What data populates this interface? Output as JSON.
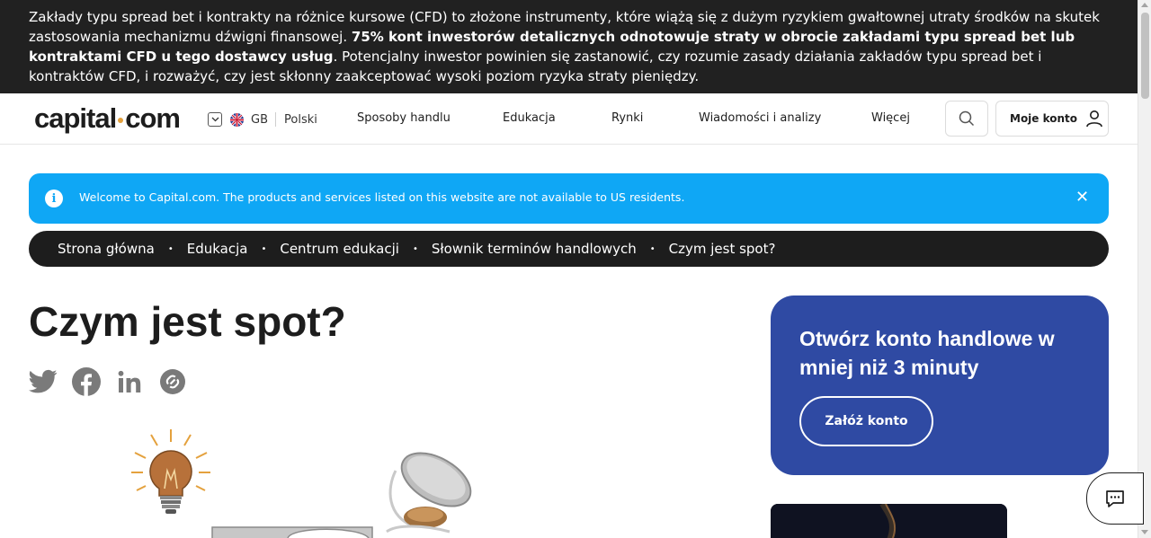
{
  "risk": {
    "part1": "Zakłady typu spread bet i kontrakty na różnice kursowe (CFD) to złożone instrumenty, które wiążą się z dużym ryzykiem gwałtownej utraty środków na skutek zastosowania mechanizmu dźwigni finansowej. ",
    "bold": "75% kont inwestorów detalicznych odnotowuje straty w obrocie zakładami typu spread bet lub kontraktami CFD u tego dostawcy usług",
    "part2": ". Potencjalny inwestor powinien się zastanowić, czy rozumie zasady działania zakładów typu spread bet i kontraktów CFD, i rozważyć, czy jest skłonny zaakceptować wysoki poziom ryzyka straty pieniędzy."
  },
  "header": {
    "logo_left": "capital",
    "logo_right": "com",
    "region_code": "GB",
    "language": "Polski",
    "nav": [
      "Sposoby handlu",
      "Edukacja",
      "Rynki",
      "Wiadomości i analizy",
      "Więcej"
    ],
    "account_label": "Moje konto"
  },
  "info": {
    "icon": "i",
    "text": "Welcome to Capital.com. The products and services listed on this website are not available to US residents.",
    "close": "✕"
  },
  "breadcrumb": [
    "Strona główna",
    "Edukacja",
    "Centrum edukacji",
    "Słownik terminów handlowych",
    "Czym jest spot?"
  ],
  "breadcrumb_separator": "•",
  "article": {
    "title": "Czym jest spot?",
    "share_icons": [
      "twitter-icon",
      "facebook-icon",
      "linkedin-icon",
      "copy-link-icon"
    ]
  },
  "promo": {
    "title": "Otwórz konto handlowe w mniej niż 3 minuty",
    "button": "Załóż konto"
  },
  "colors": {
    "risk_bg": "#212121",
    "info_bg": "#0fa7f5",
    "promo_bg": "#2f4aa3",
    "logo_dot": "#e4a13d"
  }
}
